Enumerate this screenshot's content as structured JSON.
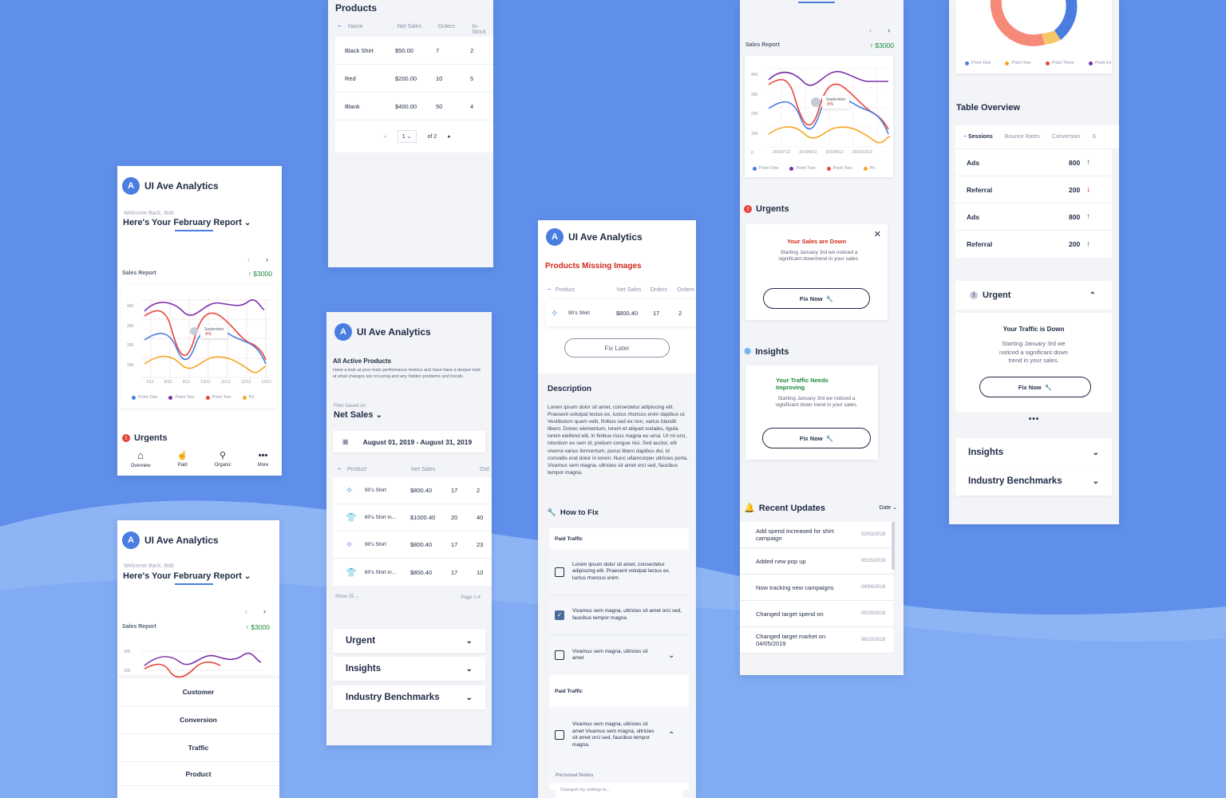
{
  "app": {
    "name": "UI Ave Analytics",
    "logo_letter": "A"
  },
  "colors": {
    "bg": "#5f8fea",
    "blue": "#4a7de0",
    "purple": "#7a2fa8",
    "red": "#e8453a",
    "orange": "#f5a623",
    "green": "#1b8a3c"
  },
  "c1": {
    "welcome": "Welcome Back, Bob",
    "report": "Here's Your February Report",
    "sales_report": "Sales Report",
    "sales_value": "$3000",
    "yticks": [
      "400",
      "300",
      "200",
      "100"
    ],
    "xticks": [
      "7/12",
      "8/12",
      "9/12",
      "10/12",
      "11/12",
      "12/12",
      "13/12"
    ],
    "tooltip_title": "September",
    "tooltip_val": "-5%",
    "legend": [
      "Point One",
      "Point Two",
      "Point Two",
      "Po"
    ],
    "urgents": "Urgents",
    "nav": [
      "Overview",
      "Paid",
      "Organic",
      "More"
    ]
  },
  "c2": {
    "welcome": "Welcome Back, Bob",
    "report": "Here's Your February Report",
    "sales_report": "Sales Report",
    "sales_value": "$3000",
    "ytick": "300",
    "ytick2": "200",
    "menu": [
      "Customer",
      "Conversion",
      "Traffic",
      "Product"
    ]
  },
  "c3": {
    "title": "Products",
    "headers": [
      "Name",
      "Net Sales",
      "Orders",
      "In-Stock"
    ],
    "rows": [
      [
        "Black Shirt",
        "$50.00",
        "7",
        "2"
      ],
      [
        "Red",
        "$200.00",
        "10",
        "5"
      ],
      [
        "Blank",
        "$400.00",
        "50",
        "4"
      ]
    ],
    "page": "1",
    "of": "of 2"
  },
  "c4": {
    "title": "All Active Products",
    "desc": "Have a look at your main performance metrics and have have a deeper look at what changes are occuring and any hidden problems and trends.",
    "filter_label": "Filter based on:",
    "filter": "Net Sales",
    "date": "August 01, 2019 - August 31, 2019",
    "headers": [
      "Product",
      "Net Sales",
      "Ord"
    ],
    "rows": [
      [
        "90's Shirt",
        "$800.40",
        "17",
        "2"
      ],
      [
        "80's Shirt in...",
        "$1000.40",
        "20",
        "40"
      ],
      [
        "90's Shirt",
        "$800.40",
        "17",
        "23"
      ],
      [
        "80's Shirt in...",
        "$800.40",
        "17",
        "10"
      ]
    ],
    "show": "Show 25",
    "page": "Page 1-4",
    "acc": [
      "Urgent",
      "Insights",
      "Industry Benchmarks"
    ]
  },
  "c5": {
    "missing": "Products Missing Images",
    "headers": [
      "Product",
      "Net Sales",
      "Orders",
      "Ordere"
    ],
    "row": [
      "90's Shirt",
      "$800.40",
      "17",
      "2"
    ],
    "fix_later": "Fix Later",
    "desc_title": "Description",
    "desc": "Lorem ipsum dolor sit amet, consectetur adipiscing elit. Praesent volutpat lectus ex, luctus rhoncus enim dapibus ut. Vestibulum quam velit, finibus sed ex non, varius blandit libero. Donec elementum, lorem et aliquet sodales, ligula lorem eleifend elit, in finibus risus magna eu urna. Ut mi orci, interdum eu sem id, pretium congue nisi. Sed auctor, elit viverra varius fermentum, purus libero dapibus dui, id convallis erat dolor in lorem. Nunc ullamcorper ultricies porta. Vivamus sem magna, ultricies sit amet orci sed, faucibus tempor magna.",
    "how": "How to Fix",
    "paid1": "Paid Traffic",
    "items": [
      "Lorem ipsum dolor sit amet, consectetur adipiscing elit. Praesent volutpat lectus ex, luctus rhoncus enim",
      "Vivamus sem magna, ultricies sit amet orci sed, faucibus tempor magna.",
      "Vivamus sem magna, ultricies sit amet"
    ],
    "paid2": "Paid Traffic",
    "item4": "Vivamus sem magna, ultricies sit amet Vivamus sem magna, ultricies sit amet orci sed, faucibus tempor magna.",
    "notes_label": "Personal Notes",
    "notes_placeholder": "Changed my settings to..."
  },
  "c6": {
    "sales_report": "Sales Report",
    "sales_value": "$3000",
    "yticks": [
      "400",
      "300",
      "200",
      "100",
      "0"
    ],
    "xticks": [
      "2019/7/12",
      "2019/8/12",
      "2019/9/12",
      "2019/10/12"
    ],
    "tooltip_title": "September",
    "tooltip_val": "-5%",
    "legend": [
      "Point One",
      "Point Two",
      "Point Two",
      "Po"
    ],
    "urgents": "Urgents",
    "urgent_title": "Your Sales are Down",
    "urgent_text": "Starting January 3rd we noticed a significant downtrend in your sales.",
    "fix": "Fix Now",
    "insights": "Insights",
    "insight_title": "Your Traffic Needs Improving",
    "insight_text": "Starting January 3rd we noticed a significant down trend in your sales.",
    "recent": "Recent Updates",
    "date": "Date",
    "updates": [
      [
        "Add spend increased for shirt campaign",
        "02/03/2019"
      ],
      [
        "Added new pop up",
        "03/15/2019"
      ],
      [
        "Now tracking new campaigns",
        "04/04/2019"
      ],
      [
        "Changed target spend on",
        "05/20/2019"
      ],
      [
        "Changed target market on 04/05/2019",
        "06/10/2019"
      ]
    ]
  },
  "c7": {
    "legend": [
      "Point One",
      "Point Two",
      "Point Three",
      "Point Fo"
    ],
    "table_title": "Table Overview",
    "tabs": [
      "Sessions",
      "Bounce Rates",
      "Conversion",
      "S"
    ],
    "rows": [
      [
        "Ads",
        "800",
        "up"
      ],
      [
        "Referral",
        "200",
        "down"
      ],
      [
        "Ads",
        "800",
        "up"
      ],
      [
        "Referral",
        "200",
        "up"
      ]
    ],
    "urgent": "Urgent",
    "urgent_title": "Your Traffic is Down",
    "urgent_text": "Starting January 3rd we noticed a significant down trend in your sales.",
    "fix": "Fix Now",
    "acc": [
      "Insights",
      "Industry Benchmarks"
    ]
  }
}
